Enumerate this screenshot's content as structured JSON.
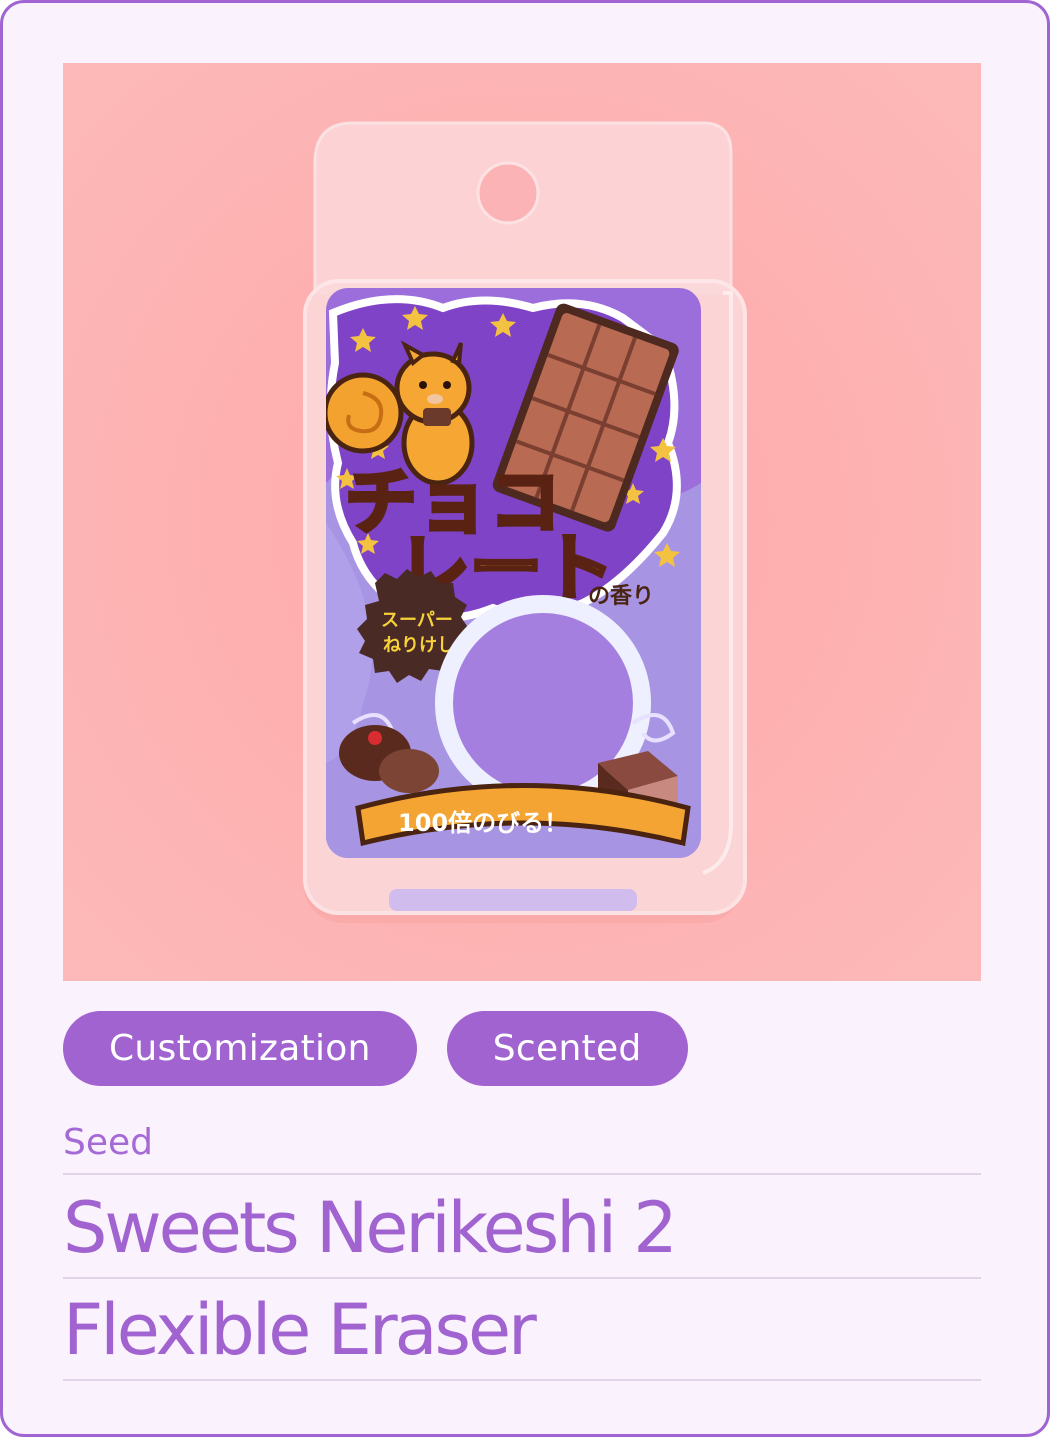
{
  "product": {
    "image_alt": "Sweets Nerikeshi 2 Flexible Eraser",
    "package_text": {
      "headline_line1": "チョコ",
      "headline_line2": "レート",
      "subline": "の香り",
      "badge_line1": "スーパー",
      "badge_line2": "ねりけし",
      "banner": "100倍のびる！"
    },
    "tags": [
      "Customization",
      "Scented"
    ],
    "brand": "Seed",
    "title_line1": "Sweets Nerikeshi 2",
    "title_line2": "Flexible Eraser"
  },
  "colors": {
    "accent": "#a163d0",
    "card_background": "#faf2fc",
    "divider": "#e0d3ea",
    "photo_background": "#fdb1b1"
  }
}
